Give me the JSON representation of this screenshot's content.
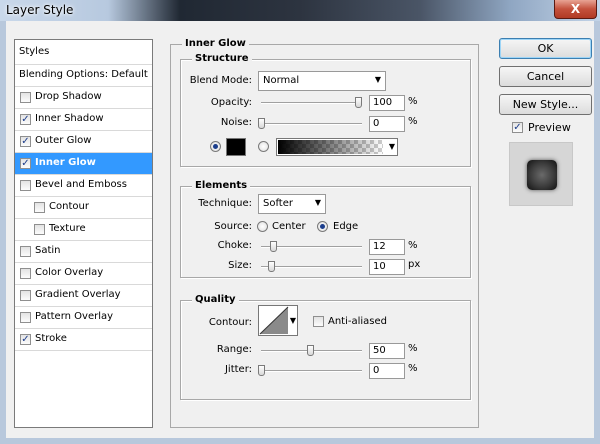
{
  "window": {
    "title": "Layer Style",
    "close_glyph": "X"
  },
  "list": {
    "header": "Styles",
    "blending": "Blending Options: Default",
    "items": [
      {
        "label": "Drop Shadow",
        "checked": false,
        "sub": false,
        "selected": false
      },
      {
        "label": "Inner Shadow",
        "checked": true,
        "sub": false,
        "selected": false
      },
      {
        "label": "Outer Glow",
        "checked": true,
        "sub": false,
        "selected": false
      },
      {
        "label": "Inner Glow",
        "checked": true,
        "sub": false,
        "selected": true
      },
      {
        "label": "Bevel and Emboss",
        "checked": false,
        "sub": false,
        "selected": false
      },
      {
        "label": "Contour",
        "checked": false,
        "sub": true,
        "selected": false
      },
      {
        "label": "Texture",
        "checked": false,
        "sub": true,
        "selected": false
      },
      {
        "label": "Satin",
        "checked": false,
        "sub": false,
        "selected": false
      },
      {
        "label": "Color Overlay",
        "checked": false,
        "sub": false,
        "selected": false
      },
      {
        "label": "Gradient Overlay",
        "checked": false,
        "sub": false,
        "selected": false
      },
      {
        "label": "Pattern Overlay",
        "checked": false,
        "sub": false,
        "selected": false
      },
      {
        "label": "Stroke",
        "checked": true,
        "sub": false,
        "selected": false
      }
    ]
  },
  "panel": {
    "title": "Inner Glow",
    "structure": {
      "title": "Structure",
      "blend_mode_label": "Blend Mode:",
      "blend_mode_value": "Normal",
      "opacity_label": "Opacity:",
      "opacity_value": "100",
      "opacity_unit": "%",
      "noise_label": "Noise:",
      "noise_value": "0",
      "noise_unit": "%",
      "glow_color": "#000000"
    },
    "elements": {
      "title": "Elements",
      "technique_label": "Technique:",
      "technique_value": "Softer",
      "source_label": "Source:",
      "source_center": "Center",
      "source_edge": "Edge",
      "choke_label": "Choke:",
      "choke_value": "12",
      "choke_unit": "%",
      "size_label": "Size:",
      "size_value": "10",
      "size_unit": "px"
    },
    "quality": {
      "title": "Quality",
      "contour_label": "Contour:",
      "antialiased_label": "Anti-aliased",
      "range_label": "Range:",
      "range_value": "50",
      "range_unit": "%",
      "jitter_label": "Jitter:",
      "jitter_value": "0",
      "jitter_unit": "%"
    }
  },
  "buttons": {
    "ok": "OK",
    "cancel": "Cancel",
    "new_style": "New Style...",
    "preview": "Preview"
  },
  "colors": {
    "selection": "#3399ff",
    "check": "#1d3d8a"
  }
}
